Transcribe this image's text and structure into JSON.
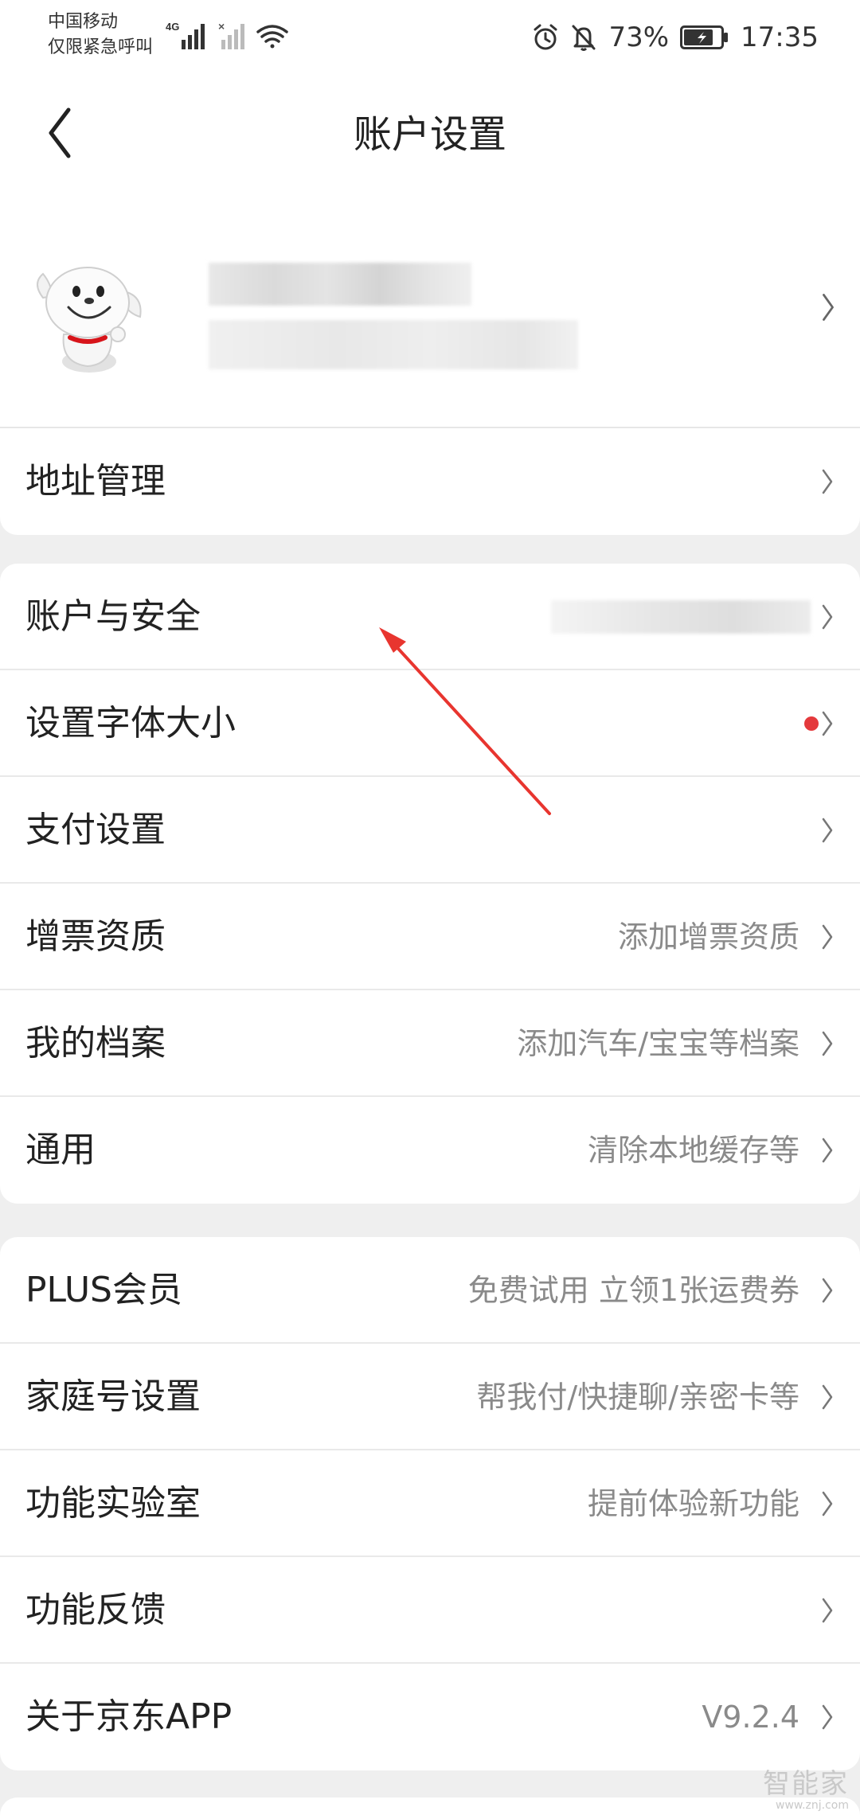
{
  "status_bar": {
    "carrier_line1": "中国移动",
    "carrier_line2": "仅限紧急呼叫",
    "network_label": "4G",
    "battery_percent": "73%",
    "time": "17:35"
  },
  "header": {
    "title": "账户设置"
  },
  "groups": [
    {
      "rows": [
        {
          "label": "地址管理",
          "value": ""
        }
      ]
    },
    {
      "rows": [
        {
          "label": "账户与安全",
          "value": ""
        },
        {
          "label": "设置字体大小",
          "value": ""
        },
        {
          "label": "支付设置",
          "value": ""
        },
        {
          "label": "增票资质",
          "value": "添加增票资质"
        },
        {
          "label": "我的档案",
          "value": "添加汽车/宝宝等档案"
        },
        {
          "label": "通用",
          "value": "清除本地缓存等"
        }
      ]
    },
    {
      "rows": [
        {
          "label": "PLUS会员",
          "value": "免费试用 立领1张运费券"
        },
        {
          "label": "家庭号设置",
          "value": "帮我付/快捷聊/亲密卡等"
        },
        {
          "label": "功能实验室",
          "value": "提前体验新功能"
        },
        {
          "label": "功能反馈",
          "value": ""
        },
        {
          "label": "关于京东APP",
          "value": "V9.2.4"
        }
      ]
    }
  ],
  "colors": {
    "accent_red": "#e4393c",
    "annotation_arrow": "#e8352f"
  },
  "icons": [
    "back-icon",
    "alarm-icon",
    "mute-icon",
    "battery-icon",
    "wifi-icon",
    "signal-icon",
    "chevron-right-icon"
  ],
  "watermark": {
    "main": "智能家",
    "sub": "www.znj.com"
  }
}
